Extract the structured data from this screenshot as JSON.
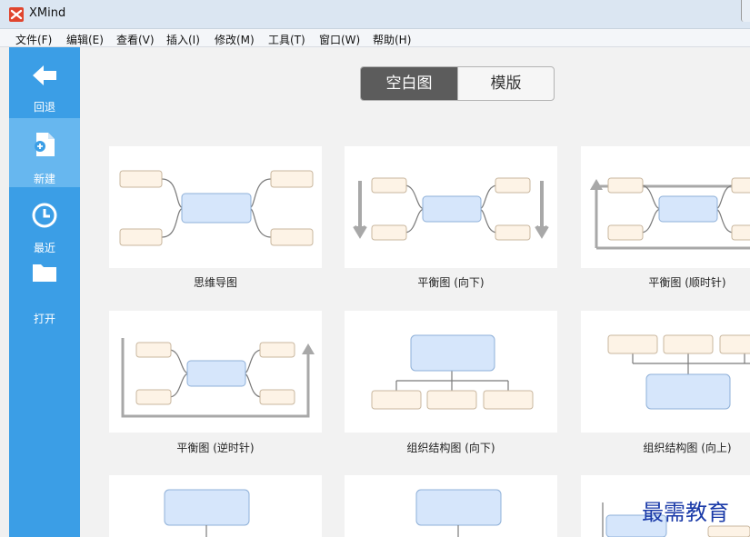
{
  "window": {
    "title": "XMind"
  },
  "menu": [
    "文件(F)",
    "编辑(E)",
    "查看(V)",
    "插入(I)",
    "修改(M)",
    "工具(T)",
    "窗口(W)",
    "帮助(H)"
  ],
  "sidebar": {
    "back": "回退",
    "new": "新建",
    "recent": "最近",
    "open": "打开"
  },
  "tabs": {
    "blank": "空白图",
    "template": "模版"
  },
  "templates": [
    "思维导图",
    "平衡图 (向下)",
    "平衡图 (顺时针)",
    "平衡图 (逆时针)",
    "组织结构图 (向下)",
    "组织结构图 (向上)"
  ],
  "watermark": "最需教育"
}
